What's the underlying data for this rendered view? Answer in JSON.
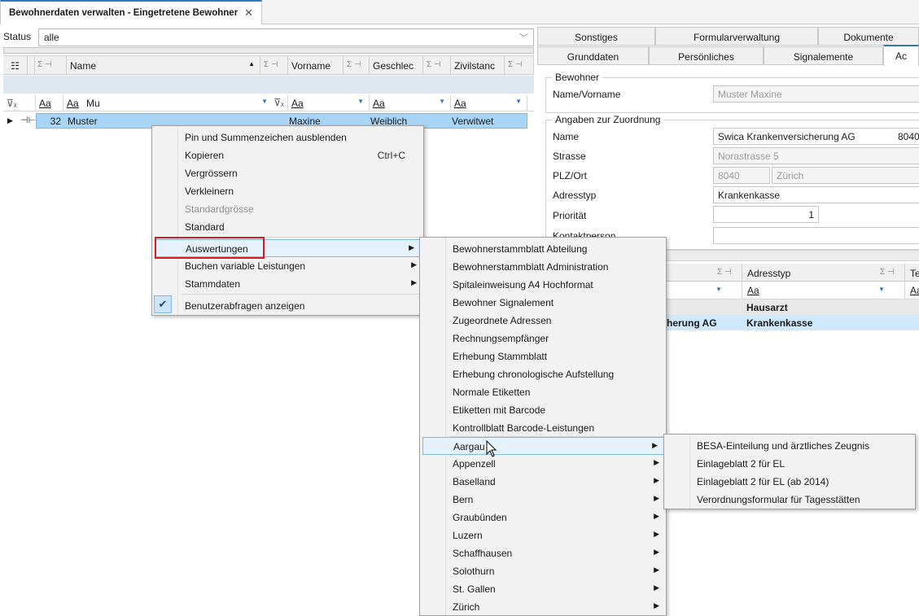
{
  "tab": {
    "title": "Bewohnerdaten verwalten - Eingetretene Bewohner",
    "close": "✕"
  },
  "status": {
    "label": "Status",
    "value": "alle"
  },
  "grid": {
    "columns": [
      "Name",
      "Vorname",
      "Geschlec",
      "Zivilstanc"
    ],
    "sigma": "Σ ⊣",
    "filters": {
      "name_value": "Mu",
      "aa": "Aa"
    },
    "row": {
      "id": "32",
      "name": "Muster",
      "vorname": "Maxine",
      "geschlecht": "Weiblich",
      "zivilstand": "Verwitwet"
    }
  },
  "menu1": {
    "items": [
      {
        "label": "Pin und Summenzeichen ausblenden"
      },
      {
        "label": "Kopieren",
        "shortcut": "Ctrl+C"
      },
      {
        "label": "Vergrössern"
      },
      {
        "label": "Verkleinern"
      },
      {
        "label": "Standardgrösse",
        "disabled": true
      },
      {
        "label": "Standard"
      },
      {
        "label": "Auswertungen"
      },
      {
        "label": "Buchen variable Leistungen"
      },
      {
        "label": "Stammdaten"
      },
      {
        "label": "Benutzerabfragen anzeigen"
      }
    ]
  },
  "menu2": {
    "items": [
      "Bewohnerstammblatt Abteilung",
      "Bewohnerstammblatt Administration",
      "Spitaleinweisung A4 Hochformat",
      "Bewohner Signalement",
      "Zugeordnete Adressen",
      "Rechnungsempfänger",
      "Erhebung Stammblatt",
      "Erhebung chronologische Aufstellung",
      "Normale Etiketten",
      "Etiketten mit Barcode",
      "Kontrollblatt Barcode-Leistungen",
      "Aargau",
      "Appenzell",
      "Baselland",
      "Bern",
      "Graubünden",
      "Luzern",
      "Schaffhausen",
      "Solothurn",
      "St. Gallen",
      "Zürich"
    ]
  },
  "menu3": {
    "items": [
      "BESA-Einteilung und ärztliches Zeugnis",
      "Einlageblatt 2 für EL",
      "Einlageblatt 2 für EL (ab 2014)",
      "Verordnungsformular für Tagesstätten"
    ]
  },
  "right": {
    "tabs_row1": [
      "Sonstiges",
      "Formularverwaltung",
      "Dokumente"
    ],
    "tabs_row2": [
      "Grunddaten",
      "Persönliches",
      "Signalemente",
      "Ac"
    ],
    "bewohner": {
      "title": "Bewohner",
      "label": "Name/Vorname",
      "value": "Muster Maxine"
    },
    "zuordnung": {
      "title": "Angaben zur Zuordnung",
      "name_label": "Name",
      "name_value": "Swica Krankenversicherung AG",
      "name_code": "8040",
      "strasse_label": "Strasse",
      "strasse_value": "Norastrasse 5",
      "plz_label": "PLZ/Ort",
      "plz_value": "8040",
      "ort_value": "Zürich",
      "typ_label": "Adresstyp",
      "typ_value": "Krankenkasse",
      "prio_label": "Priorität",
      "prio_value": "1",
      "kontakt_label": "Kontaktperson"
    },
    "grid": {
      "col_adresstyp": "Adresstyp",
      "col_te": "Te",
      "row1_typ": "Hausarzt",
      "row2_name": "herung AG",
      "row2_typ": "Krankenkasse"
    }
  },
  "colors": {
    "accent": "#2b78c5",
    "selection": "#a8d4f5",
    "highlight_border": "#d21f1f"
  }
}
